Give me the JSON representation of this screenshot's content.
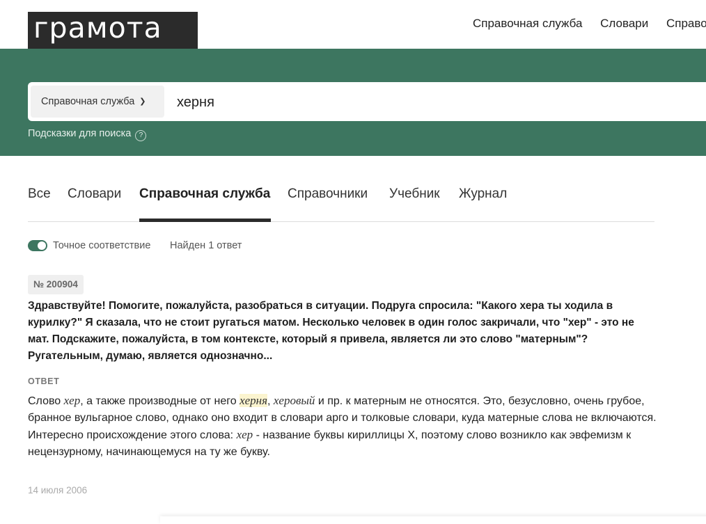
{
  "header": {
    "logo_text": "грамота",
    "nav": [
      "Справочная служба",
      "Словари",
      "Справо"
    ]
  },
  "search": {
    "scope_label": "Справочная служба",
    "query": "херня",
    "hints_label": "Подсказки для поиска",
    "hints_icon": "question-circle-icon"
  },
  "tabs": [
    "Все",
    "Словари",
    "Справочная служба",
    "Справочники",
    "Учебник",
    "Журнал"
  ],
  "active_tab": "Справочная служба",
  "filters": {
    "exact_match_label": "Точное соответствие",
    "exact_match_on": true,
    "found_text": "Найден 1 ответ"
  },
  "result": {
    "number": "№ 200904",
    "question": "Здравствуйте! Помогите, пожалуйста, разобраться в ситуации. Подруга спросила: \"Какого хера ты ходила в курилку?\" Я сказала, что не стоит ругаться матом. Несколько человек в один голос закричали, что \"хер\" - это не мат. Подскажите, пожалуйста, в том контексте, который я привела, является ли это слово \"матерным\"? Ругательным, думаю, является однозначно...",
    "answer_label": "ОТВЕТ",
    "answer": {
      "p1_a": "Слово ",
      "p1_word1": "хер",
      "p1_b": ", а также производные от него ",
      "p1_word2": "херня",
      "p1_c": ", ",
      "p1_word3": "херовый",
      "p1_d": " и пр. к матерным не относятся. Это, безусловно, очень грубое, бранное вульгарное слово, однако оно входит в словари арго и толковые словари, куда матерные слова не включаются.",
      "p2_a": "Интересно происхождение этого слова: ",
      "p2_word": "хер",
      "p2_b": " - название буквы кириллицы Х, поэтому слово возникло как эвфемизм к нецензурному, начинающемуся на ту же букву."
    },
    "date": "14 июля 2006"
  },
  "colors": {
    "brand_green": "#3d7660",
    "logo_bg": "#2b2b2b",
    "highlight": "#fbf4cf"
  }
}
